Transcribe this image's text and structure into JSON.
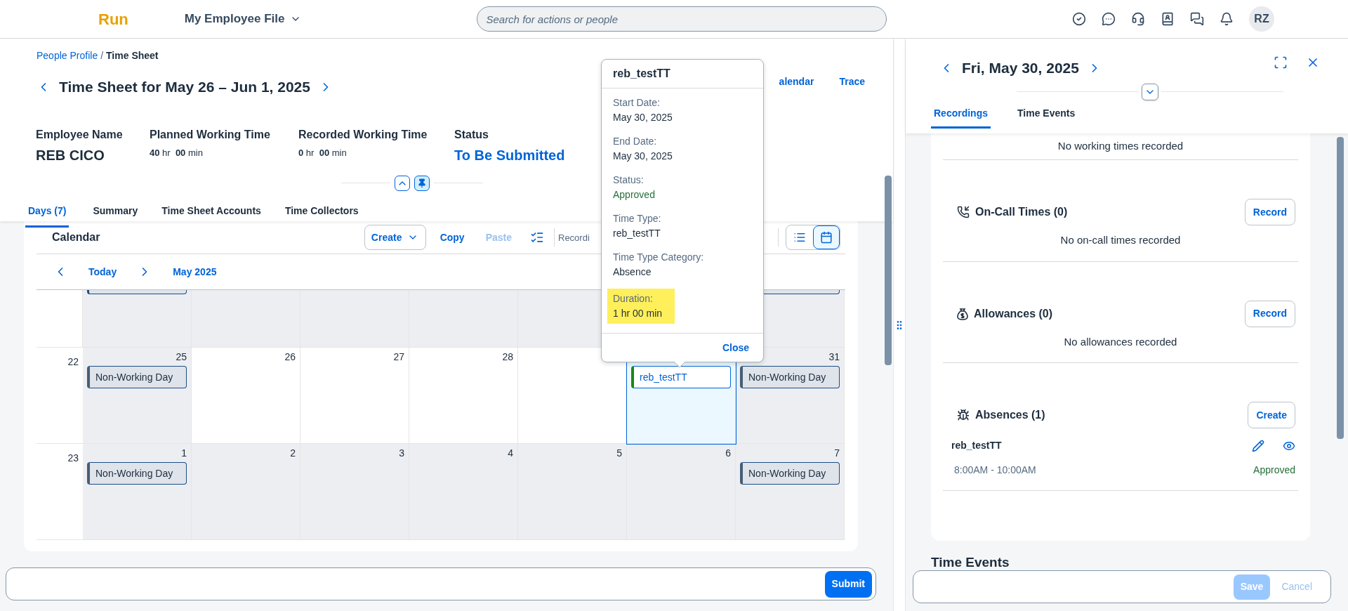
{
  "top_bar": {
    "logo": "Run",
    "menu": "My Employee File",
    "search_placeholder": "Search for actions or people",
    "avatar": "RZ"
  },
  "breadcrumb": [
    {
      "label": "People Profile",
      "separator": "/",
      "link": true
    },
    {
      "label": "Time Sheet",
      "link": false
    }
  ],
  "title": "Time Sheet for May 26 – Jun 1, 2025",
  "header_links": [
    "alendar",
    "Trace"
  ],
  "fields": [
    {
      "label": "Employee Name",
      "kind": "text",
      "value": "REB CICO"
    },
    {
      "label": "Planned Working Time",
      "kind": "duration",
      "hours": "40",
      "hr": "hr",
      "minutes": "00",
      "min": "min"
    },
    {
      "label": "Recorded Working Time",
      "kind": "duration",
      "hours": "0",
      "hr": "hr",
      "minutes": "00",
      "min": "min"
    },
    {
      "label": "Status",
      "kind": "status",
      "value": "To Be Submitted"
    }
  ],
  "pinned": true,
  "tabs": [
    {
      "label": "Days (7)",
      "selected": true
    },
    {
      "label": "Summary",
      "selected": false
    },
    {
      "label": "Time Sheet Accounts",
      "selected": false
    },
    {
      "label": "Time Collectors",
      "selected": false
    }
  ],
  "calendar": {
    "title": "Calendar",
    "create": "Create",
    "copy": "Copy",
    "paste": "Paste",
    "paste_disabled": true,
    "recording": "Recordi",
    "views": [
      {
        "kind": "list",
        "selected": false
      },
      {
        "kind": "calendar",
        "selected": true
      }
    ],
    "today": "Today",
    "month": "May 2025",
    "top_row": {
      "left_stubs": [
        true,
        false,
        false,
        false,
        false
      ],
      "right_stubs": [
        true
      ]
    },
    "weeks": [
      {
        "week": "22",
        "days": [
          {
            "day": "25",
            "shaded": true,
            "selected": false,
            "events": [
              {
                "label": "Non-Working Day",
                "kind": "non_working"
              }
            ]
          },
          {
            "day": "26",
            "shaded": false,
            "selected": false
          },
          {
            "day": "27",
            "shaded": false,
            "selected": false
          },
          {
            "day": "28",
            "shaded": false,
            "selected": false
          },
          {
            "shaded": false,
            "selected": false
          },
          {
            "selected": true,
            "events": [
              {
                "label": "reb_testTT",
                "kind": "absence"
              }
            ]
          },
          {
            "day": "31",
            "shaded": true,
            "selected": false,
            "events": [
              {
                "label": "Non-Working Day",
                "kind": "non_working"
              }
            ]
          }
        ]
      },
      {
        "week": "23",
        "days": [
          {
            "day": "1",
            "shaded": true,
            "selected": false,
            "events": [
              {
                "label": "Non-Working Day",
                "kind": "non_working"
              }
            ]
          },
          {
            "day": "2",
            "shaded": true,
            "selected": false
          },
          {
            "day": "3",
            "shaded": true,
            "selected": false
          },
          {
            "day": "4",
            "shaded": true,
            "selected": false
          },
          {
            "day": "5",
            "shaded": true,
            "selected": false
          },
          {
            "day": "6",
            "shaded": true,
            "selected": false
          },
          {
            "day": "7",
            "shaded": true,
            "selected": false,
            "events": [
              {
                "label": "Non-Working Day",
                "kind": "non_working"
              }
            ]
          }
        ]
      }
    ]
  },
  "popup": {
    "title": "reb_testTT",
    "fields": [
      {
        "label": "Start Date:",
        "value": "May 30, 2025",
        "kind": "text",
        "highlighted": false
      },
      {
        "label": "End Date:",
        "value": "May 30, 2025",
        "kind": "text",
        "highlighted": false
      },
      {
        "label": "Status:",
        "value": "Approved",
        "kind": "status",
        "highlighted": false
      },
      {
        "label": "Time Type:",
        "value": "reb_testTT",
        "kind": "text",
        "highlighted": false
      },
      {
        "label": "Time Type Category:",
        "value": "Absence",
        "kind": "text",
        "highlighted": false
      },
      {
        "label": "Duration:",
        "value": "1 hr 00 min",
        "kind": "text",
        "highlighted": true
      }
    ],
    "close": "Close"
  },
  "submit": "Submit",
  "detail": {
    "title": "Fri, May 30, 2025",
    "tabs": [
      {
        "label": "Recordings",
        "selected": true
      },
      {
        "label": "Time Events",
        "selected": false
      }
    ],
    "empty_top": "No working times recorded",
    "sections": [
      {
        "kind": "on_call",
        "title": "On-Call Times (0)",
        "button": "Record",
        "empty": "No on-call times recorded"
      },
      {
        "kind": "allowance",
        "title": "Allowances (0)",
        "button": "Record",
        "empty": "No allowances recorded"
      },
      {
        "kind": "absence",
        "title": "Absences (1)",
        "button": "Create",
        "items": [
          {
            "name": "reb_testTT",
            "time": "8:00AM - 10:00AM",
            "status": "Approved"
          }
        ]
      }
    ],
    "next_heading": "Time Events",
    "save": "Save",
    "save_disabled": true,
    "cancel": "Cancel",
    "cancel_disabled": true
  }
}
